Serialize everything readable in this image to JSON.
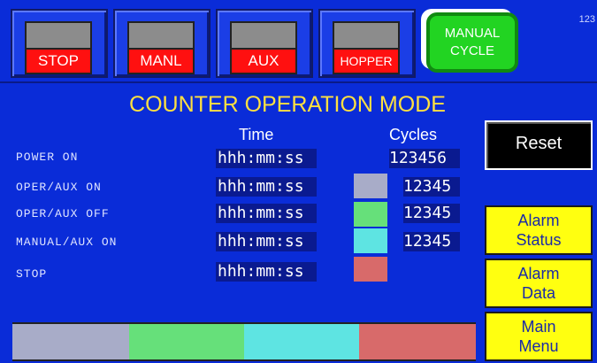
{
  "topbar": {
    "buttons": [
      {
        "label": "STOP"
      },
      {
        "label": "MANL"
      },
      {
        "label": "AUX"
      },
      {
        "label": "HOPPER"
      }
    ],
    "mode_button": {
      "line1": "MANUAL",
      "line2": "CYCLE"
    },
    "corner_number": "123"
  },
  "title": "COUNTER OPERATION MODE",
  "columns": {
    "time": "Time",
    "cycles": "Cycles"
  },
  "rows": [
    {
      "label": "POWER ON",
      "time": "hhh:mm:ss",
      "cycles": "123456",
      "swatch": ""
    },
    {
      "label": "OPER/AUX ON",
      "time": "hhh:mm:ss",
      "cycles": "12345",
      "swatch": "#a8acc8"
    },
    {
      "label": "OPER/AUX OFF",
      "time": "hhh:mm:ss",
      "cycles": "12345",
      "swatch": "#66e07a"
    },
    {
      "label": "MANUAL/AUX ON",
      "time": "hhh:mm:ss",
      "cycles": "12345",
      "swatch": "#5ee4e2"
    },
    {
      "label": "STOP",
      "time": "hhh:mm:ss",
      "cycles": "",
      "swatch": "#d86a6a"
    }
  ],
  "side": {
    "reset": "Reset",
    "alarm_status": {
      "line1": "Alarm",
      "line2": "Status"
    },
    "alarm_data": {
      "line1": "Alarm",
      "line2": "Data"
    },
    "main_menu": {
      "line1": "Main",
      "line2": "Menu"
    }
  },
  "colors": {
    "background": "#0a2cd8",
    "title": "#ffe040",
    "indicator_red": "#ff1010",
    "manual_cycle_green": "#22d422",
    "side_button_yellow": "#ffff10"
  },
  "bottom_bar": [
    "#a8acc8",
    "#66e07a",
    "#5ee4e2",
    "#d86a6a"
  ]
}
